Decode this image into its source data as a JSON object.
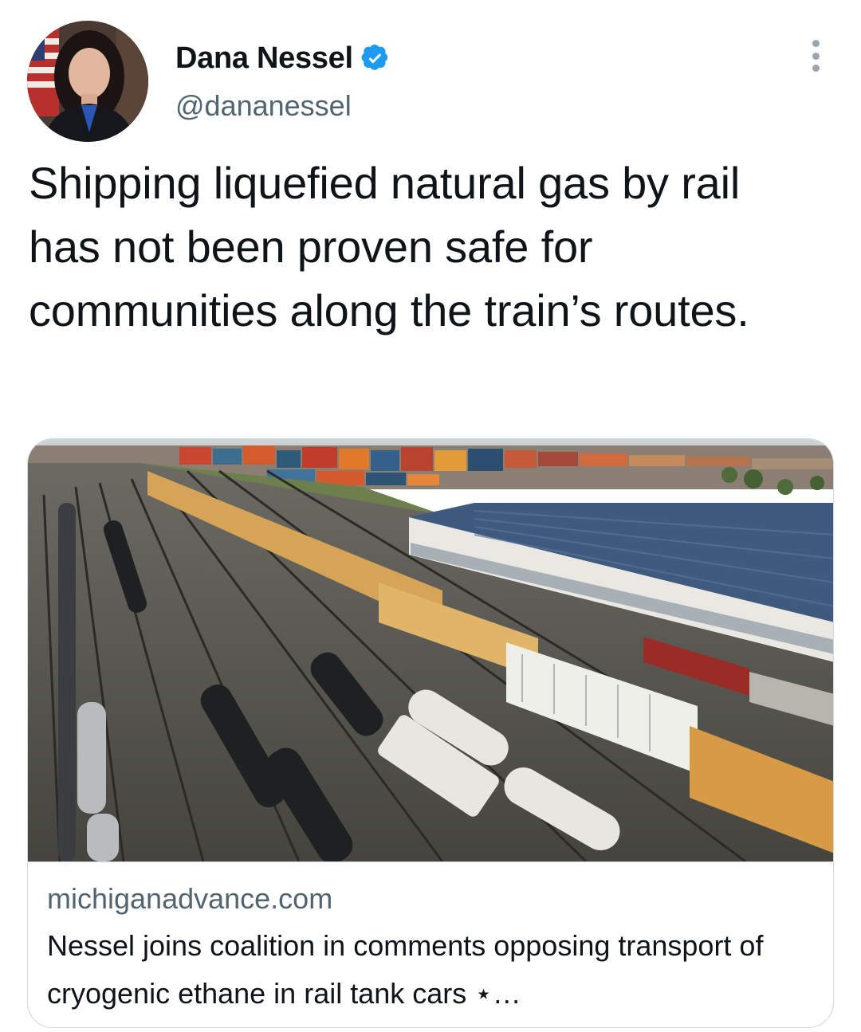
{
  "author": {
    "display_name": "Dana Nessel",
    "handle": "@dananessel",
    "verified": true,
    "verified_color": "#1d9bf0"
  },
  "tweet": {
    "text": "Shipping liquefied natural gas by rail has not been proven safe for communities along the train’s routes."
  },
  "link_card": {
    "domain": "michiganadvance.com",
    "title": "Nessel joins coalition in comments opposing transport of cryogenic ethane in rail tank cars ⋆…",
    "image_description_icon": "photo-rail-yard"
  },
  "icons": {
    "more": "more-dots-icon",
    "verified": "verified-badge-icon"
  }
}
